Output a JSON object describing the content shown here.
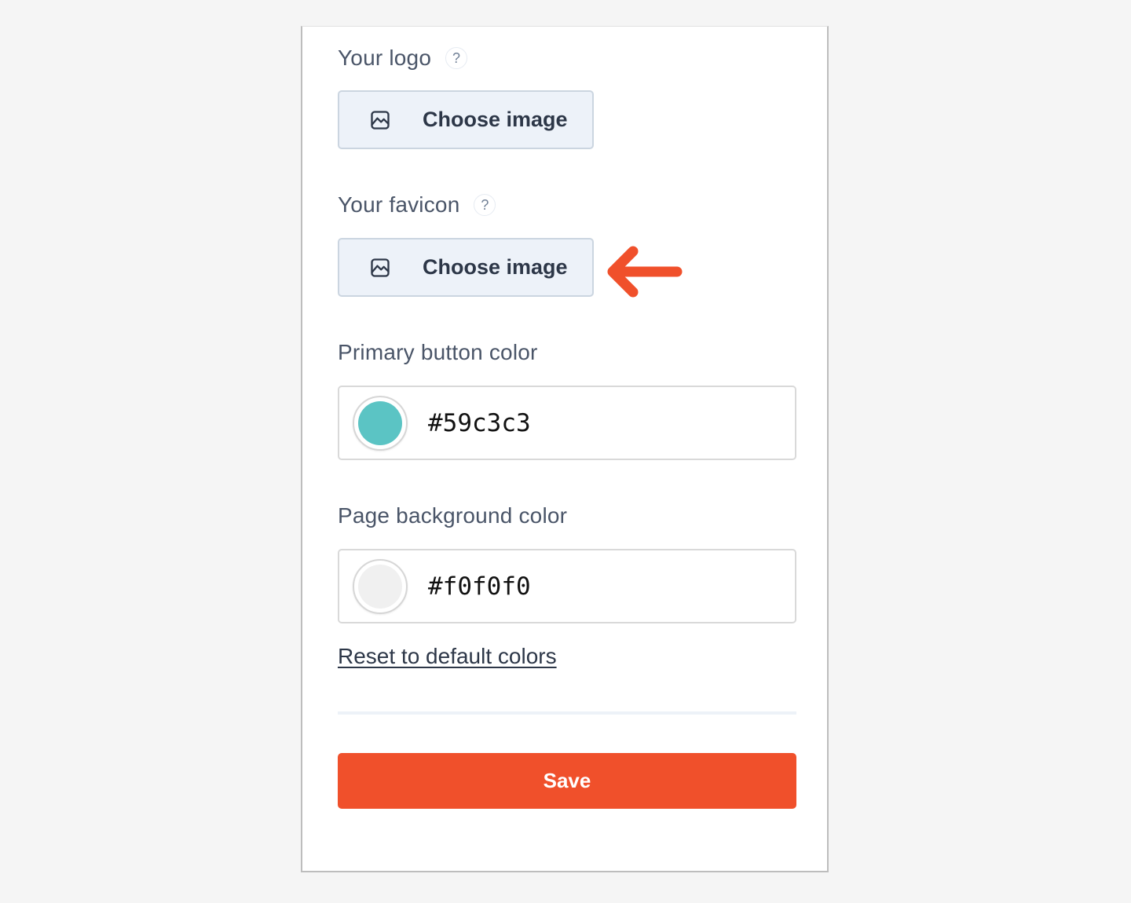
{
  "logo": {
    "label": "Your logo",
    "help": "?",
    "button_label": "Choose image"
  },
  "favicon": {
    "label": "Your favicon",
    "help": "?",
    "button_label": "Choose image"
  },
  "primary_color": {
    "label": "Primary button color",
    "value": "#59c3c3",
    "swatch": "#5bc4c4"
  },
  "background_color": {
    "label": "Page background color",
    "value": "#f0f0f0",
    "swatch": "#f0f0f0"
  },
  "reset_link": "Reset to default colors",
  "save_label": "Save",
  "annotation": {
    "icon": "arrow-left-icon",
    "color": "#f0502b"
  }
}
